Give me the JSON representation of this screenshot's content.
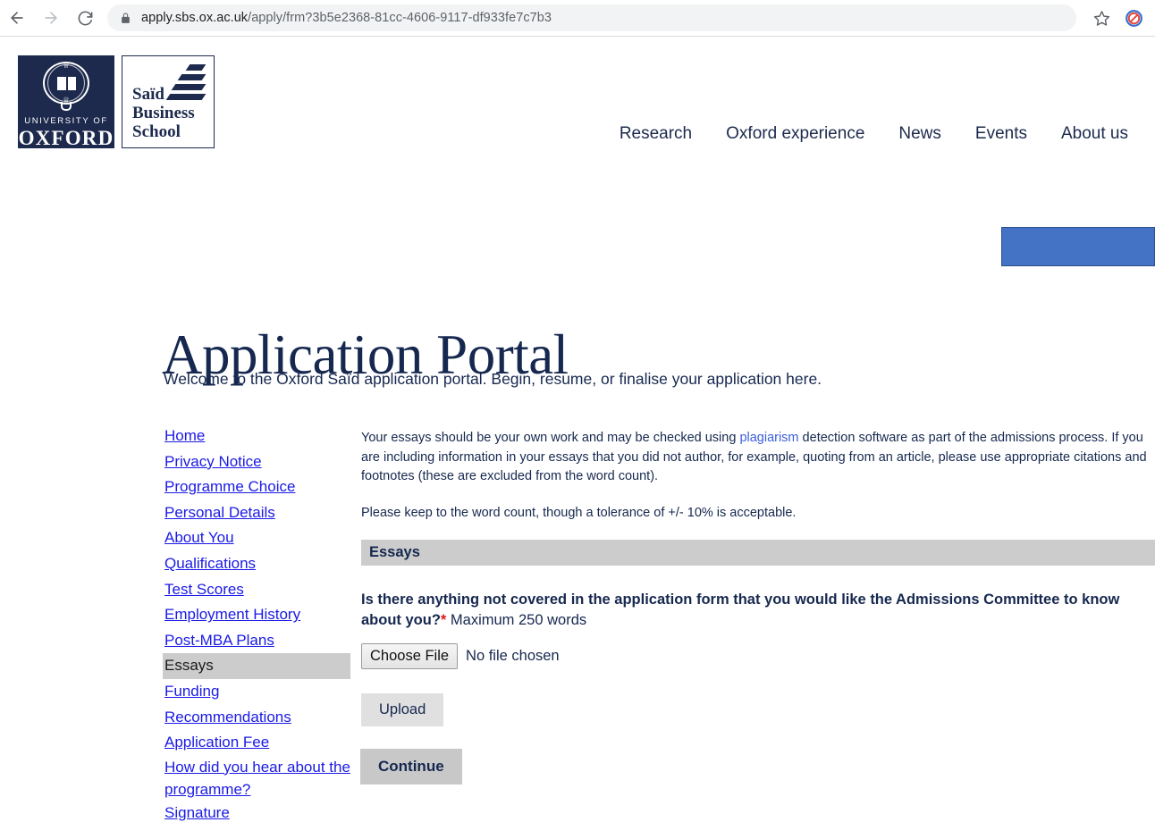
{
  "browser": {
    "back_icon": "arrow-left-icon",
    "forward_icon": "arrow-right-icon",
    "reload_icon": "reload-icon",
    "lock_icon": "lock-icon",
    "url_host": "apply.sbs.ox.ac.uk",
    "url_path": "/apply/frm?3b5e2368-81cc-4606-9117-df933fe7c7b3",
    "bookmark_icon": "star-icon",
    "blocker_icon": "block-icon"
  },
  "header": {
    "logo": {
      "university_line": "UNIVERSITY OF",
      "university_name": "OXFORD",
      "school_line1": "Saïd",
      "school_line2": "Business",
      "school_line3": "School"
    },
    "nav": [
      {
        "label": "Research"
      },
      {
        "label": "Oxford experience"
      },
      {
        "label": "News"
      },
      {
        "label": "Events"
      },
      {
        "label": "About us"
      }
    ]
  },
  "page": {
    "title": "Application Portal",
    "subtitle": "Welcome to the Oxford Saïd application portal. Begin, resume, or finalise your application here."
  },
  "sidebar": {
    "items": [
      {
        "label": "Home",
        "active": false
      },
      {
        "label": "Privacy Notice",
        "active": false
      },
      {
        "label": "Programme Choice",
        "active": false
      },
      {
        "label": "Personal Details",
        "active": false
      },
      {
        "label": "About You",
        "active": false
      },
      {
        "label": "Qualifications",
        "active": false
      },
      {
        "label": "Test Scores",
        "active": false
      },
      {
        "label": "Employment History",
        "active": false
      },
      {
        "label": "Post-MBA Plans",
        "active": false
      },
      {
        "label": "Essays",
        "active": true
      },
      {
        "label": "Funding",
        "active": false
      },
      {
        "label": "Recommendations",
        "active": false
      },
      {
        "label": "Application Fee",
        "active": false
      },
      {
        "label": "How did you hear about the programme?",
        "active": false
      },
      {
        "label": "Signature",
        "active": false
      }
    ]
  },
  "main": {
    "intro_part1": "Your essays should be your own work and may be checked using ",
    "intro_link": "plagiarism",
    "intro_part2": " detection software as part of the admissions process. If you are including information in your essays that you did not author, for example, quoting from an article, please use appropriate citations and footnotes (these are excluded from the word count).",
    "tolerance_note": "Please keep to the word count, though a tolerance of +/- 10% is acceptable.",
    "section_title": "Essays",
    "question_text": "Is there anything not covered in the application form that you would like the Admissions Committee to know about you?",
    "question_required_marker": "*",
    "question_hint": " Maximum 250 words",
    "choose_file_label": "Choose File",
    "file_status": "No file chosen",
    "upload_label": "Upload",
    "continue_label": "Continue"
  },
  "colors": {
    "brand_navy": "#16284f",
    "link_blue": "#1a1ae6",
    "accent_blue": "#4472c4",
    "required_red": "#e01b1b",
    "section_gray": "#cccccc"
  }
}
